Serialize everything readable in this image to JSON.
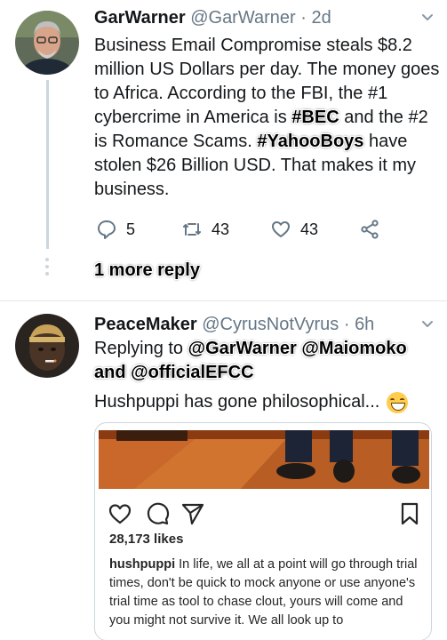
{
  "tweets": [
    {
      "name": "GarWarner",
      "handle": "@GarWarner",
      "separator": "·",
      "time": "2d",
      "text_parts": {
        "p1": "Business Email Compromise steals $8.2 million US Dollars per day.  The money goes to Africa.  According to the FBI, the #1 cybercrime in America is ",
        "tag1": "#BEC",
        "p2": " and the #2 is Romance Scams.  ",
        "tag2": "#YahooBoys",
        "p3": " have stolen $26 Billion USD.  That makes it my business."
      },
      "actions": {
        "replies": "5",
        "retweets": "43",
        "likes": "43"
      },
      "more_reply": "1 more reply"
    },
    {
      "name": "PeaceMaker",
      "handle": "@CyrusNotVyrus",
      "separator": "·",
      "time": "6h",
      "replying_to_label": "Replying to",
      "mentions": [
        "@GarWarner",
        "@Maiomoko",
        "and @officialEFCC"
      ],
      "text": "Hushpuppi has gone philosophical...",
      "emoji": "grinning-squinting-face",
      "embedded_post": {
        "likes": "28,173 likes",
        "username": "hushpuppi",
        "caption": "In life, we all at a point will go through trial times, don't be quick to mock anyone or use anyone's trial time as tool to chase clout, yours will come and you might not survive it. We all look up to"
      }
    }
  ],
  "colors": {
    "text": "#14171a",
    "secondary": "#657786",
    "border": "#e1e8ed",
    "emoji": "#ffcc4d"
  }
}
